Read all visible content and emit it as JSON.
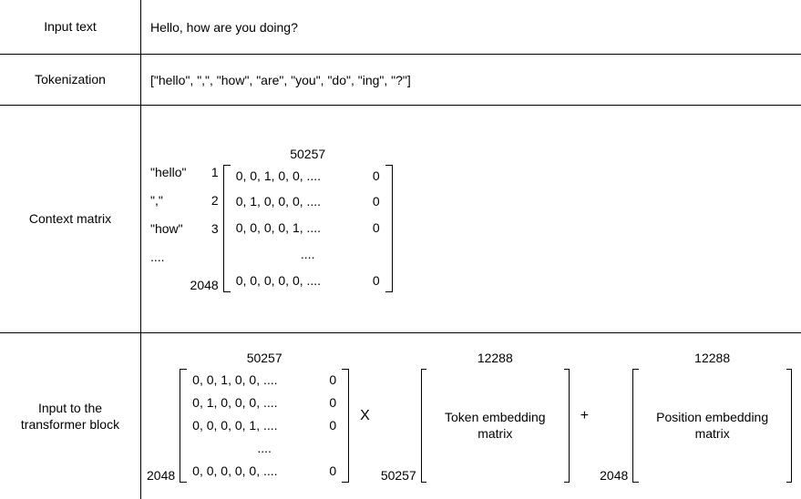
{
  "rows": {
    "input": {
      "label": "Input text",
      "text": "Hello, how are you doing?"
    },
    "token": {
      "label": "Tokenization",
      "text": "[\"hello\", \",\", \"how\", \"are\", \"you\", \"do\", \"ing\", \"?\"]"
    },
    "context": {
      "label": "Context matrix"
    },
    "trans": {
      "label": "Input to the transformer block"
    }
  },
  "dims": {
    "vocab": "50257",
    "embed": "12288",
    "context": "2048"
  },
  "ctx": {
    "tokens": {
      "t1": "\"hello\"",
      "t2": "\",\"",
      "t3": "\"how\"",
      "dots": "...."
    },
    "idx": {
      "i1": "1",
      "i2": "2",
      "i3": "3"
    },
    "rowsA": {
      "r1l": "0, 0, 1, 0, 0, ....",
      "r1r": "0",
      "r2l": "0, 1, 0, 0, 0, ....",
      "r2r": "0",
      "r3l": "0, 0, 0, 0, 1, ....",
      "r3r": "0",
      "rdl": "....",
      "rnl": "0, 0, 0, 0, 0, ....",
      "rnr": "0"
    }
  },
  "ops": {
    "mult": "X",
    "plus": "+"
  },
  "matrices": {
    "token_embed": "Token embedding matrix",
    "pos_embed": "Position embedding matrix"
  }
}
